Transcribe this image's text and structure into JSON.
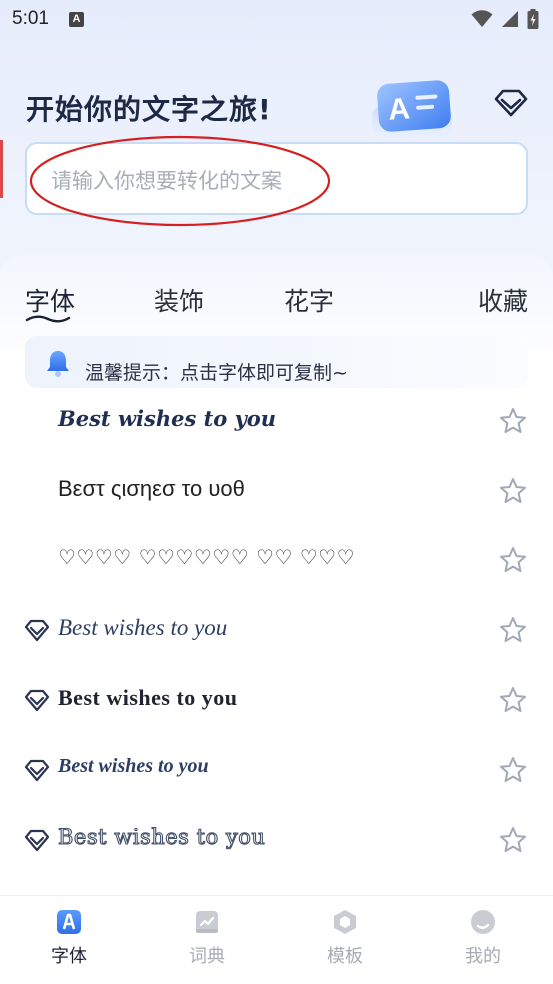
{
  "status_bar": {
    "time": "5:01",
    "notification_glyph": "A"
  },
  "header": {
    "title": "开始你的文字之旅!",
    "art_glyph": "A"
  },
  "search": {
    "placeholder": "请输入你想要转化的文案",
    "value": ""
  },
  "tabs": [
    {
      "label": "字体",
      "active": true
    },
    {
      "label": "装饰",
      "active": false
    },
    {
      "label": "花字",
      "active": false
    },
    {
      "label": "收藏",
      "active": false
    }
  ],
  "notice": {
    "text": "温馨提示：点击字体即可复制~"
  },
  "font_list": [
    {
      "text": "Best wishes to you",
      "vip": false,
      "favorited": false
    },
    {
      "text": "Βεστ ςισηεσ το υοθ",
      "vip": false,
      "favorited": false
    },
    {
      "text": "♡♡♡♡ ♡♡♡♡♡♡ ♡♡ ♡♡♡",
      "vip": false,
      "favorited": false
    },
    {
      "text": "Best wishes to you",
      "vip": true,
      "favorited": false
    },
    {
      "text": "Best wishes to you",
      "vip": true,
      "favorited": false
    },
    {
      "text": "Best wishes to you",
      "vip": true,
      "favorited": false
    },
    {
      "text": "Best wishes to you",
      "vip": true,
      "favorited": false
    }
  ],
  "bottom_nav": [
    {
      "label": "字体",
      "icon": "font-a-icon",
      "active": true
    },
    {
      "label": "词典",
      "icon": "dictionary-icon",
      "active": false
    },
    {
      "label": "模板",
      "icon": "template-cube-icon",
      "active": false
    },
    {
      "label": "我的",
      "icon": "profile-moon-icon",
      "active": false
    }
  ],
  "colors": {
    "accent_blue": "#3b82f6",
    "annotation_red": "#d42020",
    "text_dark": "#1e2a45",
    "nav_inactive": "#a8abb3"
  }
}
